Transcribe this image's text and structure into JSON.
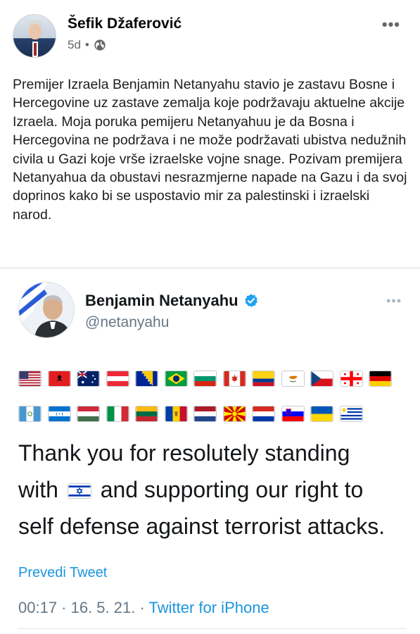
{
  "post": {
    "author": "Šefik Džaferović",
    "time": "5d",
    "separator": "•",
    "visibility_icon": "globe-icon",
    "more_icon": "•••",
    "text": "Premijer Izraela Benjamin Netanyahu stavio je zastavu Bosne i Hercegovine uz zastave zemalja koje podržavaju aktuelne akcije Izraela. Moja poruka pemijeru Netanyahuu je da Bosna i Hercegovina ne podržava i ne može podržavati ubistva nedužnih civila u Gazi koje vrše izraelske vojne snage. Pozivam premijera Netanyahua da obustavi nesrazmjerne napade na Gazu i da svoj doprinos kako bi se uspostavio mir za palestinski i izraelski narod."
  },
  "tweet": {
    "name": "Benjamin Netanyahu",
    "handle": "@netanyahu",
    "more_icon": "•••",
    "verified_icon": "verified-badge-icon",
    "flags_row1": [
      "us",
      "al",
      "au",
      "at",
      "ba",
      "br",
      "bg",
      "ca",
      "co",
      "cy",
      "cz",
      "ge",
      "de"
    ],
    "flags_row2": [
      "gt",
      "hn",
      "hu",
      "it",
      "lt",
      "md",
      "nl",
      "mk",
      "py",
      "si",
      "ua",
      "uy"
    ],
    "text_line1": "Thank you for resolutely standing",
    "text_line2_a": "with",
    "text_line2_b": "and supporting our right to",
    "text_line3": "self defense against terrorist attacks.",
    "translate_label": "Prevedi Tweet",
    "timestamp": "00:17 · 16. 5. 21. · ",
    "source": "Twitter for iPhone"
  },
  "colors": {
    "link_blue": "#1b95e0",
    "verified_blue": "#1da1f2",
    "meta_gray": "#65676b"
  }
}
